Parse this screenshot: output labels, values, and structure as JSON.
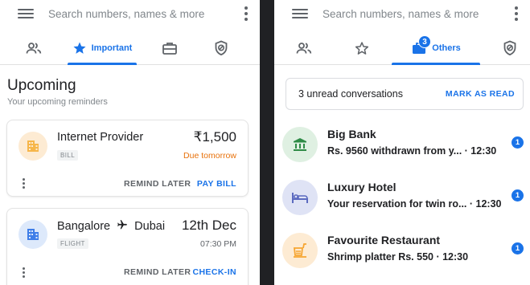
{
  "left": {
    "search": {
      "placeholder": "Search numbers, names & more"
    },
    "tabs": [
      {
        "icon": "people-icon",
        "label": ""
      },
      {
        "icon": "star-icon",
        "label": "Important",
        "active": true
      },
      {
        "icon": "briefcase-icon",
        "label": ""
      },
      {
        "icon": "shield-icon",
        "label": ""
      }
    ],
    "section": {
      "title": "Upcoming",
      "subtitle": "Your upcoming reminders"
    },
    "cards": [
      {
        "title": "Internet Provider",
        "tag": "BILL",
        "amount": "₹1,500",
        "due": "Due tomorrow",
        "due_color": "#e8710a",
        "secondary_action": "REMIND LATER",
        "primary_action": "PAY BILL",
        "icon": "building-icon",
        "avatar_bg": "#fdebd3",
        "icon_color": "#f6b64a"
      },
      {
        "title_from": "Bangalore",
        "title_to": "Dubai",
        "tag": "FLIGHT",
        "date": "12th Dec",
        "time": "07:30 PM",
        "secondary_action": "REMIND LATER",
        "primary_action": "CHECK-IN",
        "icon": "building-icon",
        "avatar_bg": "#dde9fb",
        "icon_color": "#3f7ee8"
      }
    ]
  },
  "right": {
    "search": {
      "placeholder": "Search numbers, names & more"
    },
    "tabs": [
      {
        "icon": "people-icon",
        "label": ""
      },
      {
        "icon": "star-outline-icon",
        "label": ""
      },
      {
        "icon": "briefcase-icon",
        "label": "Others",
        "badge": "3",
        "active": true
      },
      {
        "icon": "shield-icon",
        "label": ""
      }
    ],
    "unread": {
      "text": "3 unread conversations",
      "action": "MARK AS READ"
    },
    "conversations": [
      {
        "name": "Big Bank",
        "preview": "Rs. 9560 withdrawn from y... · 12:30",
        "count": "1",
        "icon": "bank-icon",
        "avatar_bg": "#dff0e2",
        "icon_color": "#2e8b46"
      },
      {
        "name": "Luxury Hotel",
        "preview": "Your reservation for twin ro... · 12:30",
        "count": "1",
        "icon": "bed-icon",
        "avatar_bg": "#dfe3f5",
        "icon_color": "#5c6bc0"
      },
      {
        "name": "Favourite Restaurant",
        "preview": "Shrimp platter Rs. 550 · 12:30",
        "count": "1",
        "icon": "food-icon",
        "avatar_bg": "#fdebd3",
        "icon_color": "#f6a531"
      }
    ]
  },
  "colors": {
    "accent": "#1a73e8",
    "text": "#202124",
    "muted": "#80868b"
  }
}
